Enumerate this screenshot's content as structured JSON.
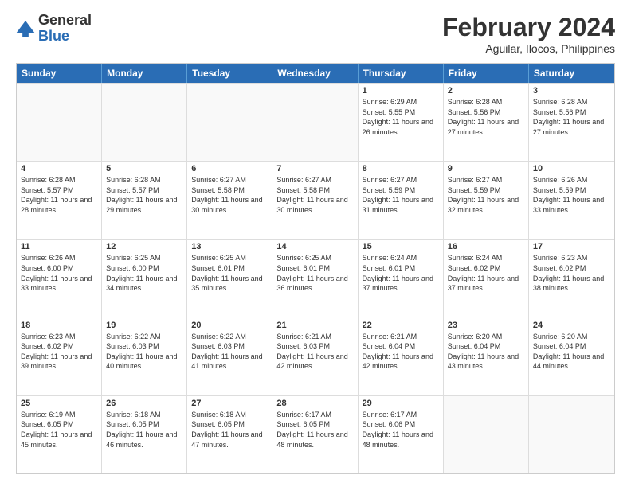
{
  "logo": {
    "line1": "General",
    "line2": "Blue"
  },
  "title": "February 2024",
  "location": "Aguilar, Ilocos, Philippines",
  "days": [
    "Sunday",
    "Monday",
    "Tuesday",
    "Wednesday",
    "Thursday",
    "Friday",
    "Saturday"
  ],
  "weeks": [
    [
      {
        "day": "",
        "empty": true
      },
      {
        "day": "",
        "empty": true
      },
      {
        "day": "",
        "empty": true
      },
      {
        "day": "",
        "empty": true
      },
      {
        "day": "1",
        "sunrise": "Sunrise: 6:29 AM",
        "sunset": "Sunset: 5:55 PM",
        "daylight": "Daylight: 11 hours and 26 minutes."
      },
      {
        "day": "2",
        "sunrise": "Sunrise: 6:28 AM",
        "sunset": "Sunset: 5:56 PM",
        "daylight": "Daylight: 11 hours and 27 minutes."
      },
      {
        "day": "3",
        "sunrise": "Sunrise: 6:28 AM",
        "sunset": "Sunset: 5:56 PM",
        "daylight": "Daylight: 11 hours and 27 minutes."
      }
    ],
    [
      {
        "day": "4",
        "sunrise": "Sunrise: 6:28 AM",
        "sunset": "Sunset: 5:57 PM",
        "daylight": "Daylight: 11 hours and 28 minutes."
      },
      {
        "day": "5",
        "sunrise": "Sunrise: 6:28 AM",
        "sunset": "Sunset: 5:57 PM",
        "daylight": "Daylight: 11 hours and 29 minutes."
      },
      {
        "day": "6",
        "sunrise": "Sunrise: 6:27 AM",
        "sunset": "Sunset: 5:58 PM",
        "daylight": "Daylight: 11 hours and 30 minutes."
      },
      {
        "day": "7",
        "sunrise": "Sunrise: 6:27 AM",
        "sunset": "Sunset: 5:58 PM",
        "daylight": "Daylight: 11 hours and 30 minutes."
      },
      {
        "day": "8",
        "sunrise": "Sunrise: 6:27 AM",
        "sunset": "Sunset: 5:59 PM",
        "daylight": "Daylight: 11 hours and 31 minutes."
      },
      {
        "day": "9",
        "sunrise": "Sunrise: 6:27 AM",
        "sunset": "Sunset: 5:59 PM",
        "daylight": "Daylight: 11 hours and 32 minutes."
      },
      {
        "day": "10",
        "sunrise": "Sunrise: 6:26 AM",
        "sunset": "Sunset: 5:59 PM",
        "daylight": "Daylight: 11 hours and 33 minutes."
      }
    ],
    [
      {
        "day": "11",
        "sunrise": "Sunrise: 6:26 AM",
        "sunset": "Sunset: 6:00 PM",
        "daylight": "Daylight: 11 hours and 33 minutes."
      },
      {
        "day": "12",
        "sunrise": "Sunrise: 6:25 AM",
        "sunset": "Sunset: 6:00 PM",
        "daylight": "Daylight: 11 hours and 34 minutes."
      },
      {
        "day": "13",
        "sunrise": "Sunrise: 6:25 AM",
        "sunset": "Sunset: 6:01 PM",
        "daylight": "Daylight: 11 hours and 35 minutes."
      },
      {
        "day": "14",
        "sunrise": "Sunrise: 6:25 AM",
        "sunset": "Sunset: 6:01 PM",
        "daylight": "Daylight: 11 hours and 36 minutes."
      },
      {
        "day": "15",
        "sunrise": "Sunrise: 6:24 AM",
        "sunset": "Sunset: 6:01 PM",
        "daylight": "Daylight: 11 hours and 37 minutes."
      },
      {
        "day": "16",
        "sunrise": "Sunrise: 6:24 AM",
        "sunset": "Sunset: 6:02 PM",
        "daylight": "Daylight: 11 hours and 37 minutes."
      },
      {
        "day": "17",
        "sunrise": "Sunrise: 6:23 AM",
        "sunset": "Sunset: 6:02 PM",
        "daylight": "Daylight: 11 hours and 38 minutes."
      }
    ],
    [
      {
        "day": "18",
        "sunrise": "Sunrise: 6:23 AM",
        "sunset": "Sunset: 6:02 PM",
        "daylight": "Daylight: 11 hours and 39 minutes."
      },
      {
        "day": "19",
        "sunrise": "Sunrise: 6:22 AM",
        "sunset": "Sunset: 6:03 PM",
        "daylight": "Daylight: 11 hours and 40 minutes."
      },
      {
        "day": "20",
        "sunrise": "Sunrise: 6:22 AM",
        "sunset": "Sunset: 6:03 PM",
        "daylight": "Daylight: 11 hours and 41 minutes."
      },
      {
        "day": "21",
        "sunrise": "Sunrise: 6:21 AM",
        "sunset": "Sunset: 6:03 PM",
        "daylight": "Daylight: 11 hours and 42 minutes."
      },
      {
        "day": "22",
        "sunrise": "Sunrise: 6:21 AM",
        "sunset": "Sunset: 6:04 PM",
        "daylight": "Daylight: 11 hours and 42 minutes."
      },
      {
        "day": "23",
        "sunrise": "Sunrise: 6:20 AM",
        "sunset": "Sunset: 6:04 PM",
        "daylight": "Daylight: 11 hours and 43 minutes."
      },
      {
        "day": "24",
        "sunrise": "Sunrise: 6:20 AM",
        "sunset": "Sunset: 6:04 PM",
        "daylight": "Daylight: 11 hours and 44 minutes."
      }
    ],
    [
      {
        "day": "25",
        "sunrise": "Sunrise: 6:19 AM",
        "sunset": "Sunset: 6:05 PM",
        "daylight": "Daylight: 11 hours and 45 minutes."
      },
      {
        "day": "26",
        "sunrise": "Sunrise: 6:18 AM",
        "sunset": "Sunset: 6:05 PM",
        "daylight": "Daylight: 11 hours and 46 minutes."
      },
      {
        "day": "27",
        "sunrise": "Sunrise: 6:18 AM",
        "sunset": "Sunset: 6:05 PM",
        "daylight": "Daylight: 11 hours and 47 minutes."
      },
      {
        "day": "28",
        "sunrise": "Sunrise: 6:17 AM",
        "sunset": "Sunset: 6:05 PM",
        "daylight": "Daylight: 11 hours and 48 minutes."
      },
      {
        "day": "29",
        "sunrise": "Sunrise: 6:17 AM",
        "sunset": "Sunset: 6:06 PM",
        "daylight": "Daylight: 11 hours and 48 minutes."
      },
      {
        "day": "",
        "empty": true
      },
      {
        "day": "",
        "empty": true
      }
    ]
  ]
}
